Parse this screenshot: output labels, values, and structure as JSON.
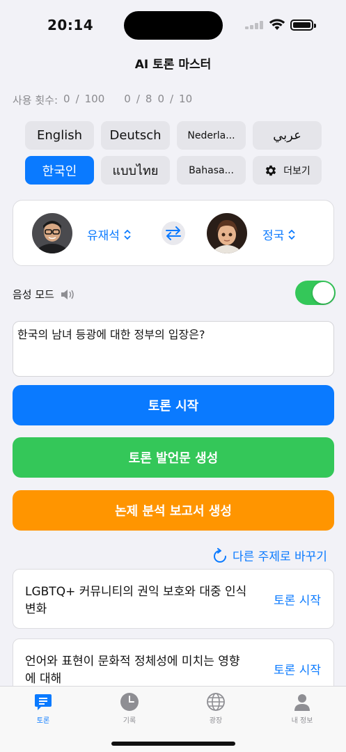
{
  "status": {
    "time": "20:14"
  },
  "app": {
    "title": "AI 토론 마스터"
  },
  "usage": {
    "label": "사용 횟수:",
    "count1": "0",
    "sep1": "/",
    "total1": "100",
    "count2": "0",
    "sep2": "/",
    "total2": "8",
    "count3": "0",
    "sep3": "/",
    "total3": "10"
  },
  "languages": [
    {
      "label": "English",
      "active": false
    },
    {
      "label": "Deutsch",
      "active": false
    },
    {
      "label": "Nederla...",
      "active": false
    },
    {
      "label": "عربي",
      "active": false
    },
    {
      "label": "한국인",
      "active": true
    },
    {
      "label": "แบบไทย",
      "active": false
    },
    {
      "label": "Bahasa...",
      "active": false
    }
  ],
  "more_button": {
    "label": "더보기",
    "icon": "gear-icon"
  },
  "speakers": {
    "left": {
      "name": "유재석",
      "icon": "chevron-updown-icon"
    },
    "right": {
      "name": "정국",
      "icon": "chevron-updown-icon"
    },
    "swap_icon": "swap-arrows-icon"
  },
  "voice_mode": {
    "label": "음성 모드",
    "icon": "speaker-icon",
    "enabled": true
  },
  "topic_input": {
    "value": "한국의 남녀 등광에 대한 정부의 입장은?"
  },
  "buttons": {
    "start": "토론 시작",
    "speech": "토론 발언문 생성",
    "report": "논제 분석 보고서 생성"
  },
  "refresh": {
    "label": "다른 주제로 바꾸기",
    "icon": "refresh-icon"
  },
  "suggested_topics": [
    {
      "text": "LGBTQ+ 커뮤니티의 권익 보호와 대중 인식 변화",
      "action": "토론 시작"
    },
    {
      "text": "언어와 표현이 문화적 정체성에 미치는 영향에 대해",
      "action": "토론 시작"
    }
  ],
  "tabs": [
    {
      "label": "토론",
      "icon": "chat-bubble-icon",
      "active": true
    },
    {
      "label": "기록",
      "icon": "clock-icon",
      "active": false
    },
    {
      "label": "광장",
      "icon": "globe-icon",
      "active": false
    },
    {
      "label": "내 정보",
      "icon": "person-icon",
      "active": false
    }
  ],
  "colors": {
    "accent": "#0a7aff",
    "green": "#34c759",
    "orange": "#ff9500"
  }
}
